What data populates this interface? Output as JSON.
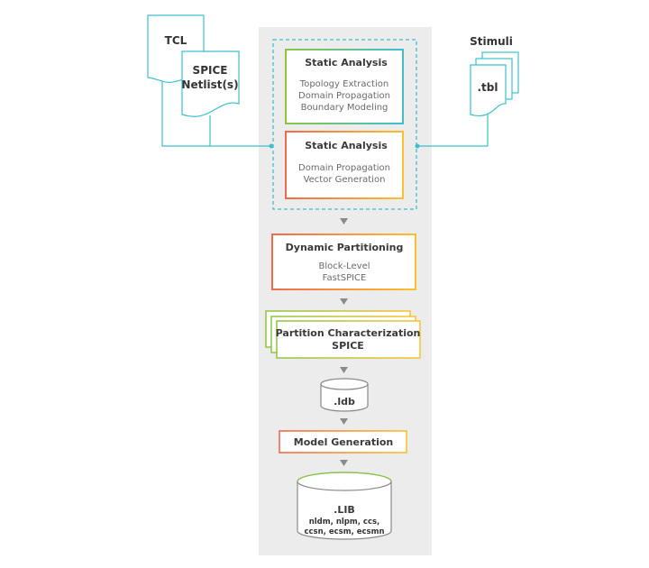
{
  "colors": {
    "connector": "#3cc0cc",
    "panel": "#ebeceb",
    "green": "#8cc63f",
    "teal": "#3cc0cc",
    "red": "#f06a4a",
    "yellow": "#fbc02d",
    "arrow": "#8a8a8a"
  },
  "inputs": {
    "tcl": "TCL",
    "spice_line1": "SPICE",
    "spice_line2": "Netlist(s)",
    "stimuli_label": "Stimuli",
    "tbl": ".tbl"
  },
  "static_analysis_1": {
    "title": "Static Analysis",
    "lines": [
      "Topology Extraction",
      "Domain Propagation",
      "Boundary Modeling"
    ]
  },
  "static_analysis_2": {
    "title": "Static Analysis",
    "lines": [
      "Domain Propagation",
      "Vector Generation"
    ]
  },
  "dynamic_partitioning": {
    "title": "Dynamic Partitioning",
    "lines": [
      "Block-Level",
      "FastSPICE"
    ]
  },
  "partition_characterization": {
    "title": "Partition Characterization",
    "subtitle": "SPICE"
  },
  "ldb": ".ldb",
  "model_generation": "Model Generation",
  "lib": {
    "title": ".LIB",
    "line1": "nldm, nlpm, ccs,",
    "line2": "ccsn, ecsm, ecsmn"
  }
}
